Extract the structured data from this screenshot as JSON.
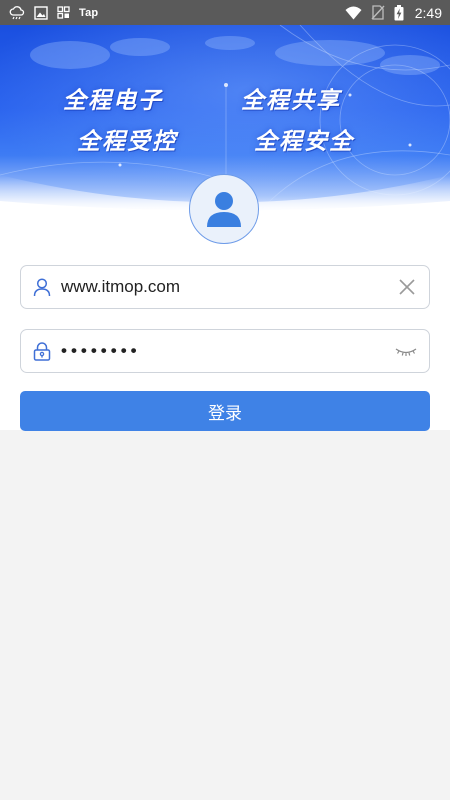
{
  "status_bar": {
    "app_label": "Tap",
    "time": "2:49",
    "icons": [
      "weather-cloud-icon",
      "image-icon",
      "grid-app-icon",
      "wifi-icon",
      "no-sim-icon",
      "battery-charging-icon"
    ]
  },
  "banner": {
    "slogans": [
      "全程电子",
      "全程共享",
      "全程受控",
      "全程安全"
    ]
  },
  "login": {
    "username": {
      "value": "www.itmop.com",
      "icon": "user-icon",
      "clear_icon": "clear-icon"
    },
    "password": {
      "masked_value": "••••••••",
      "icon": "lock-icon",
      "visibility_icon": "eye-closed-icon"
    },
    "submit_label": "登录"
  },
  "colors": {
    "banner_blue": "#2a63ee",
    "button_blue": "#3f82e6",
    "background": "#f3f3f3"
  }
}
